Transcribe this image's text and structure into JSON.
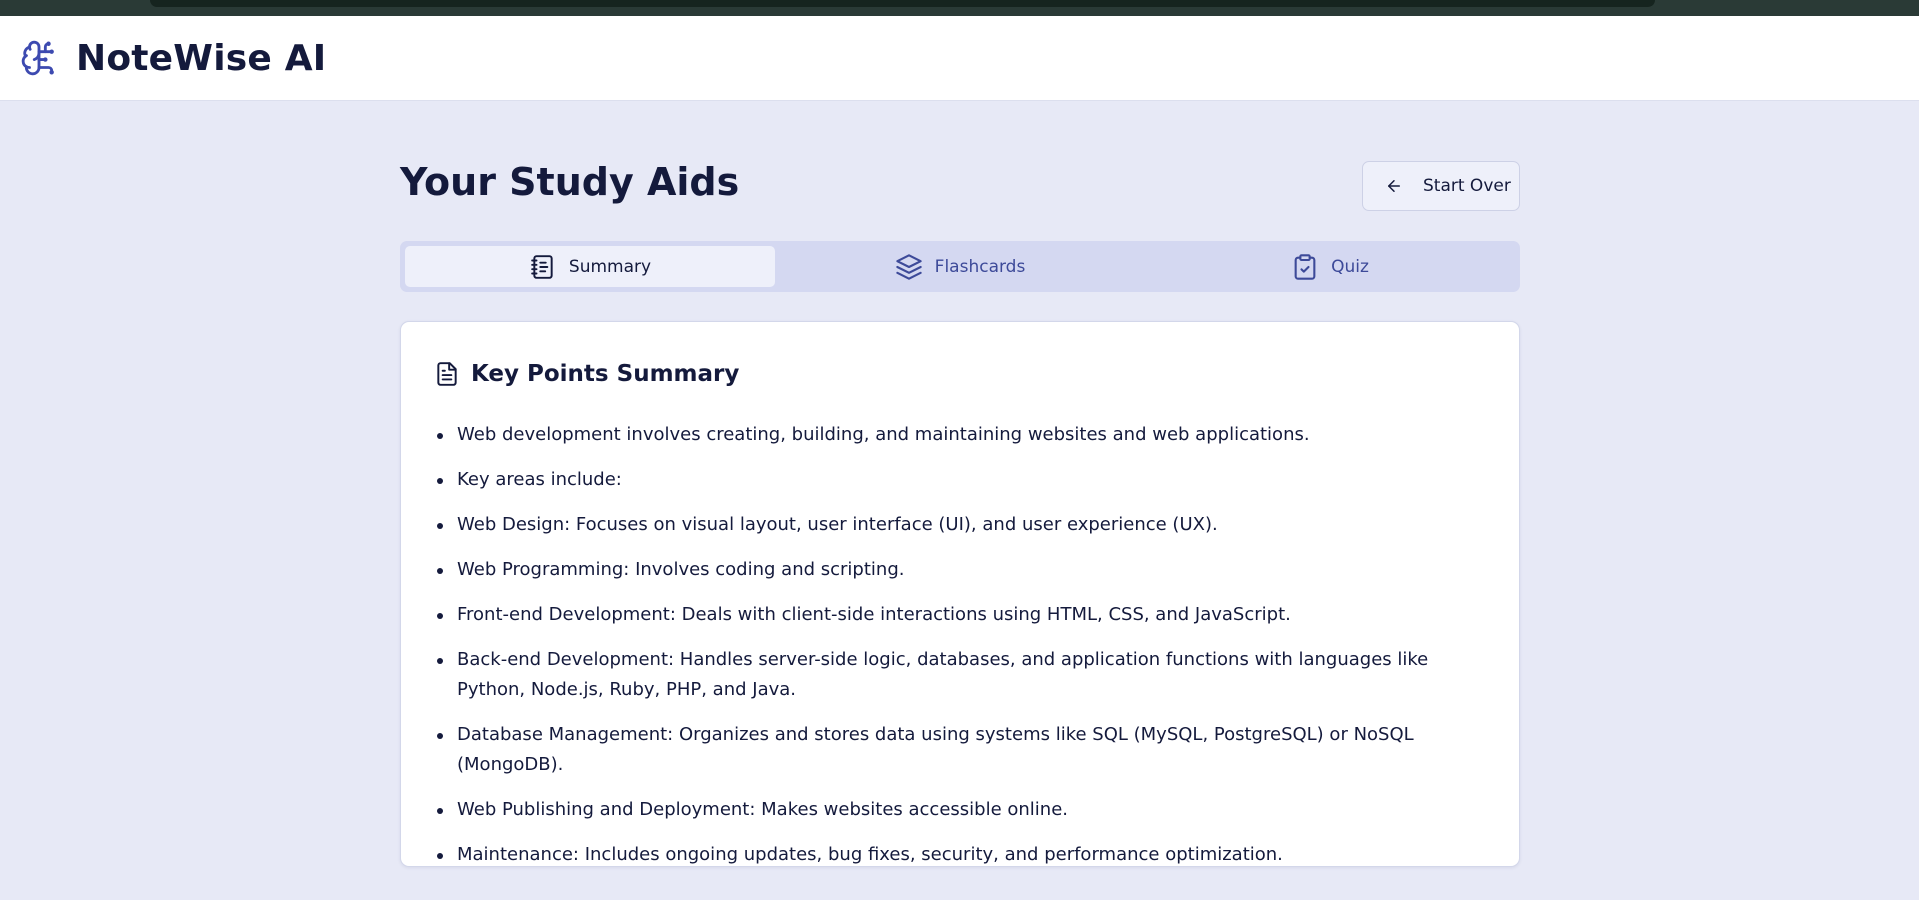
{
  "app": {
    "title": "NoteWise AI",
    "logo_icon": "brain-icon"
  },
  "page": {
    "title": "Your Study Aids",
    "start_over_label": "Start Over",
    "start_over_icon": "arrow-left-icon"
  },
  "tabs": [
    {
      "label": "Summary",
      "icon": "notebook-icon",
      "active": true
    },
    {
      "label": "Flashcards",
      "icon": "layers-icon",
      "active": false
    },
    {
      "label": "Quiz",
      "icon": "clipboard-check-icon",
      "active": false
    }
  ],
  "summary": {
    "title": "Key Points Summary",
    "icon": "document-icon",
    "points": [
      "Web development involves creating, building, and maintaining websites and web applications.",
      "Key areas include:",
      "Web Design: Focuses on visual layout, user interface (UI), and user experience (UX).",
      "Web Programming: Involves coding and scripting.",
      "Front-end Development: Deals with client-side interactions using HTML, CSS, and JavaScript.",
      "Back-end Development: Handles server-side logic, databases, and application functions with languages like Python, Node.js, Ruby, PHP, and Java.",
      "Database Management: Organizes and stores data using systems like SQL (MySQL, PostgreSQL) or NoSQL (MongoDB).",
      "Web Publishing and Deployment: Makes websites accessible online.",
      "Maintenance: Includes ongoing updates, bug fixes, security, and performance optimization."
    ]
  },
  "colors": {
    "background": "#e7e9f6",
    "text": "#141a3c",
    "accent": "#3d4a99",
    "tab_bar": "#d4d8f1"
  }
}
